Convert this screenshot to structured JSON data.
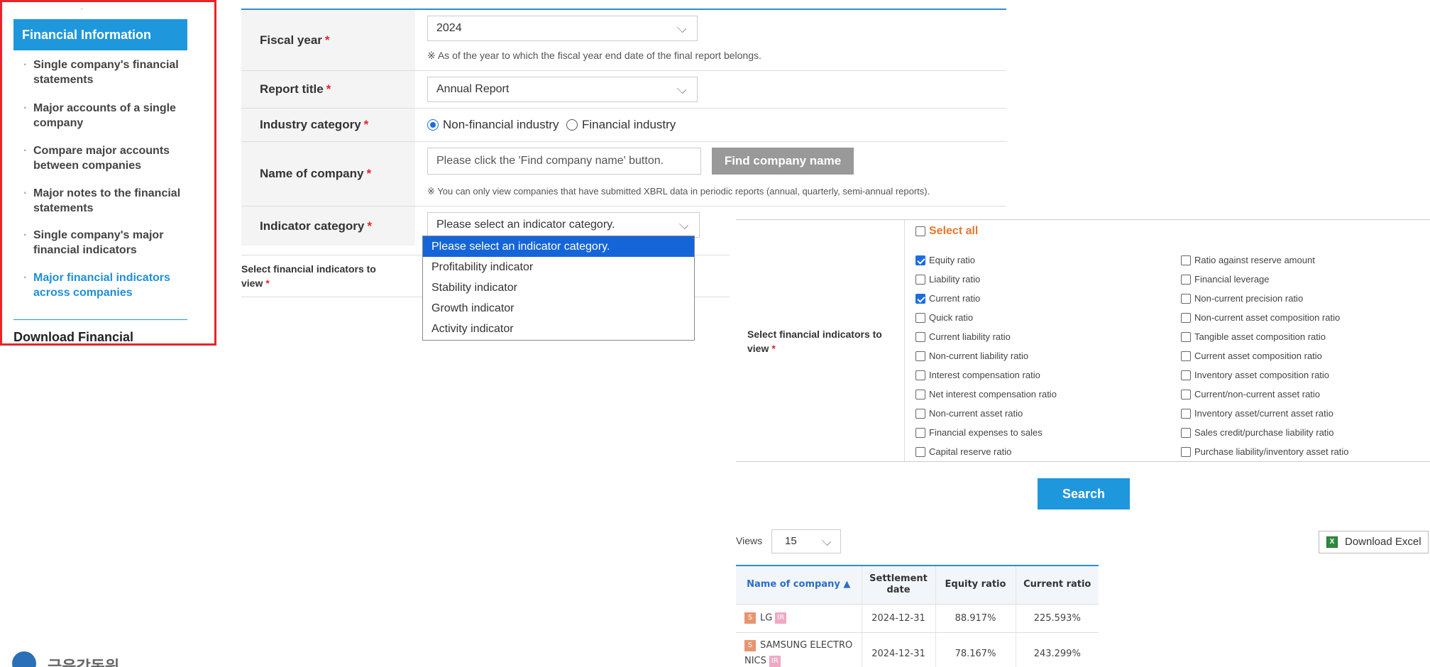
{
  "sidebar": {
    "dot": "·",
    "header": "Financial Information",
    "items": [
      {
        "label": "Single company's financial statements",
        "active": false
      },
      {
        "label": "Major accounts of a single company",
        "active": false
      },
      {
        "label": "Compare major accounts between companies",
        "active": false
      },
      {
        "label": "Major notes to the financial statements",
        "active": false
      },
      {
        "label": "Single company's major financial indicators",
        "active": false
      },
      {
        "label": "Major financial indicators across companies",
        "active": true
      }
    ],
    "next_section": "Download Financial",
    "bullet": "·"
  },
  "form": {
    "required_mark": "*",
    "fiscal_year": {
      "label": "Fiscal year",
      "value": "2024",
      "note": "※ As of the year to which the fiscal year end date of the final report belongs."
    },
    "report_title": {
      "label": "Report title",
      "value": "Annual Report"
    },
    "industry": {
      "label": "Industry category",
      "options": [
        "Non-financial industry",
        "Financial industry"
      ],
      "selected": "Non-financial industry"
    },
    "company": {
      "label": "Name of company",
      "placeholder": "Please click the 'Find company name' button.",
      "button": "Find company name",
      "note": "※ You can only view companies that have submitted XBRL data in periodic reports (annual, quarterly, semi-annual reports)."
    },
    "indicator": {
      "label": "Indicator category",
      "value": "Please select an indicator category."
    },
    "select_indicators_label": "Select financial indicators to view"
  },
  "dropdown": {
    "options": [
      "Please select an indicator category.",
      "Profitability indicator",
      "Stability indicator",
      "Growth indicator",
      "Activity indicator"
    ],
    "selected_index": 0
  },
  "indicators": {
    "label": "Select financial indicators to view",
    "select_all": "Select all",
    "left": [
      {
        "label": "Equity ratio",
        "checked": true
      },
      {
        "label": "Liability ratio",
        "checked": false
      },
      {
        "label": "Current ratio",
        "checked": true
      },
      {
        "label": "Quick ratio",
        "checked": false
      },
      {
        "label": "Current liability ratio",
        "checked": false
      },
      {
        "label": "Non-current liability ratio",
        "checked": false
      },
      {
        "label": "Interest compensation ratio",
        "checked": false
      },
      {
        "label": "Net interest compensation ratio",
        "checked": false
      },
      {
        "label": "Non-current asset ratio",
        "checked": false
      },
      {
        "label": "Financial expenses to sales",
        "checked": false
      },
      {
        "label": "Capital reserve ratio",
        "checked": false
      }
    ],
    "right": [
      {
        "label": "Ratio against reserve amount",
        "checked": false
      },
      {
        "label": "Financial leverage",
        "checked": false
      },
      {
        "label": "Non-current precision ratio",
        "checked": false
      },
      {
        "label": "Non-current asset composition ratio",
        "checked": false
      },
      {
        "label": "Tangible asset composition ratio",
        "checked": false
      },
      {
        "label": "Current asset composition ratio",
        "checked": false
      },
      {
        "label": "Inventory asset composition ratio",
        "checked": false
      },
      {
        "label": "Current/non-current asset ratio",
        "checked": false
      },
      {
        "label": "Inventory asset/current asset ratio",
        "checked": false
      },
      {
        "label": "Sales credit/purchase liability ratio",
        "checked": false
      },
      {
        "label": "Purchase liability/inventory asset ratio",
        "checked": false
      }
    ]
  },
  "search_button": "Search",
  "results": {
    "views_label": "Views",
    "views_value": "15",
    "excel_button": "Download Excel",
    "excel_icon_glyph": "X",
    "columns": [
      "Name of company ▲",
      "Settlement date",
      "Equity ratio",
      "Current ratio"
    ],
    "rows": [
      {
        "tag": "S",
        "name_lines": [
          "LG"
        ],
        "ir": "IR",
        "date": "2024-12-31",
        "equity": "88.917%",
        "current": "225.593%"
      },
      {
        "tag": "S",
        "name_lines": [
          "SAMSUNG ELECTRO",
          "NICS"
        ],
        "ir": "IR",
        "date": "2024-12-31",
        "equity": "78.167%",
        "current": "243.299%"
      }
    ]
  },
  "logo_text": "금융감독원",
  "colors": {
    "accent": "#1f97dc",
    "required": "#e8232a",
    "highlight_border": "#e8232a",
    "dropdown_selected": "#1565d8"
  }
}
